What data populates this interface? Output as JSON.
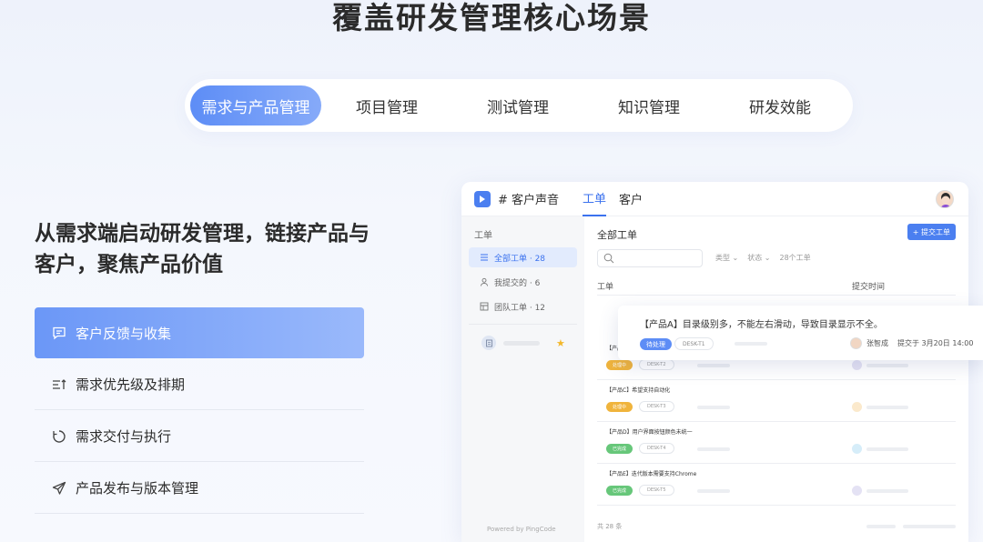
{
  "headline": "覆盖研发管理核心场景",
  "tabs": [
    {
      "label": "需求与产品管理",
      "active": true
    },
    {
      "label": "项目管理"
    },
    {
      "label": "测试管理"
    },
    {
      "label": "知识管理"
    },
    {
      "label": "研发效能"
    }
  ],
  "subtitle_line1": "从需求端启动研发管理，链接产品与",
  "subtitle_line2": "客户，聚焦产品价值",
  "features": [
    {
      "label": "客户反馈与收集",
      "icon": "message-icon",
      "active": true
    },
    {
      "label": "需求优先级及排期",
      "icon": "priority-list-icon"
    },
    {
      "label": "需求交付与执行",
      "icon": "cycle-icon"
    },
    {
      "label": "产品发布与版本管理",
      "icon": "send-icon"
    }
  ],
  "app": {
    "title": "# 客户声音",
    "tabs": [
      "工单",
      "客户"
    ],
    "sidebar": {
      "heading": "工单",
      "items": [
        {
          "label": "全部工单 · 28",
          "icon": "list-icon"
        },
        {
          "label": "我提交的 · 6",
          "icon": "user-icon"
        },
        {
          "label": "团队工单 · 12",
          "icon": "team-icon"
        }
      ],
      "powered": "Powered by PingCode"
    },
    "main": {
      "heading": "全部工单",
      "submit_label": "+ 提交工单",
      "filter_type": "类型 ⌄",
      "filter_status": "状态 ⌄",
      "count": "28个工单",
      "col_ticket": "工单",
      "col_time": "提交时间",
      "rows": [
        {
          "title": "【产品",
          "status": "处理中",
          "code": "DESK-T2",
          "color": "#f0b43c",
          "dot": "#e4e2f4"
        },
        {
          "title": "【产品C】希望支持自动化",
          "status": "处理中",
          "code": "DESK-T3",
          "color": "#f0b43c",
          "dot": "#fbe9cc"
        },
        {
          "title": "【产品D】用户界面按钮颜色未统一",
          "status": "已完成",
          "code": "DESK-T4",
          "color": "#67c77a",
          "dot": "#d6edf9"
        },
        {
          "title": "【产品E】迭代版本需要支持Chrome",
          "status": "已完成",
          "code": "DESK-T5",
          "color": "#67c77a",
          "dot": "#e4e2f4"
        }
      ],
      "footer": "共 28 条"
    }
  },
  "floating_card": {
    "title": "【产品A】目录级别多，不能左右滑动，导致目录显示不全。",
    "status": "待处理",
    "code": "DESK-T1",
    "user": "张智成",
    "submit": "提交于 3月20日 14:00"
  }
}
